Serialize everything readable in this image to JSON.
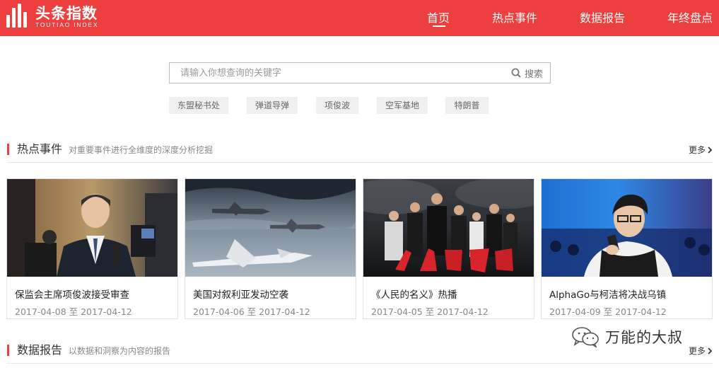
{
  "header": {
    "logo_cn": "头条指数",
    "logo_en": "TOUTIAO INDEX",
    "nav": [
      {
        "label": "首页",
        "active": true
      },
      {
        "label": "热点事件",
        "active": false
      },
      {
        "label": "数据报告",
        "active": false
      },
      {
        "label": "年终盘点",
        "active": false
      }
    ],
    "brand_color": "#ee3f3f"
  },
  "search": {
    "placeholder": "请输入你想查询的关键字",
    "button_label": "搜索",
    "hot_tags": [
      "东盟秘书处",
      "弹道导弹",
      "项俊波",
      "空军基地",
      "特朗普"
    ]
  },
  "hot_events": {
    "title": "热点事件",
    "subtitle": "对重要事件进行全维度的深度分析挖掘",
    "more_label": "更多",
    "cards": [
      {
        "title": "保监会主席项俊波接受审查",
        "date_range": "2017-04-08 至 2017-04-12",
        "image": "official-press-photo"
      },
      {
        "title": "美国对叙利亚发动空袭",
        "date_range": "2017-04-06 至 2017-04-12",
        "image": "bombers-in-flight"
      },
      {
        "title": "《人民的名义》热播",
        "date_range": "2017-04-05 至 2017-04-12",
        "image": "tv-drama-poster"
      },
      {
        "title": "AlphaGo与柯洁将决战乌镇",
        "date_range": "2017-04-09 至 2017-04-12",
        "image": "go-player-stage"
      }
    ]
  },
  "data_reports": {
    "title": "数据报告",
    "subtitle": "以数据和洞察为内容的报告",
    "more_label": "更多"
  },
  "watermark": {
    "text": "万能的大叔",
    "icon": "wechat-icon"
  }
}
